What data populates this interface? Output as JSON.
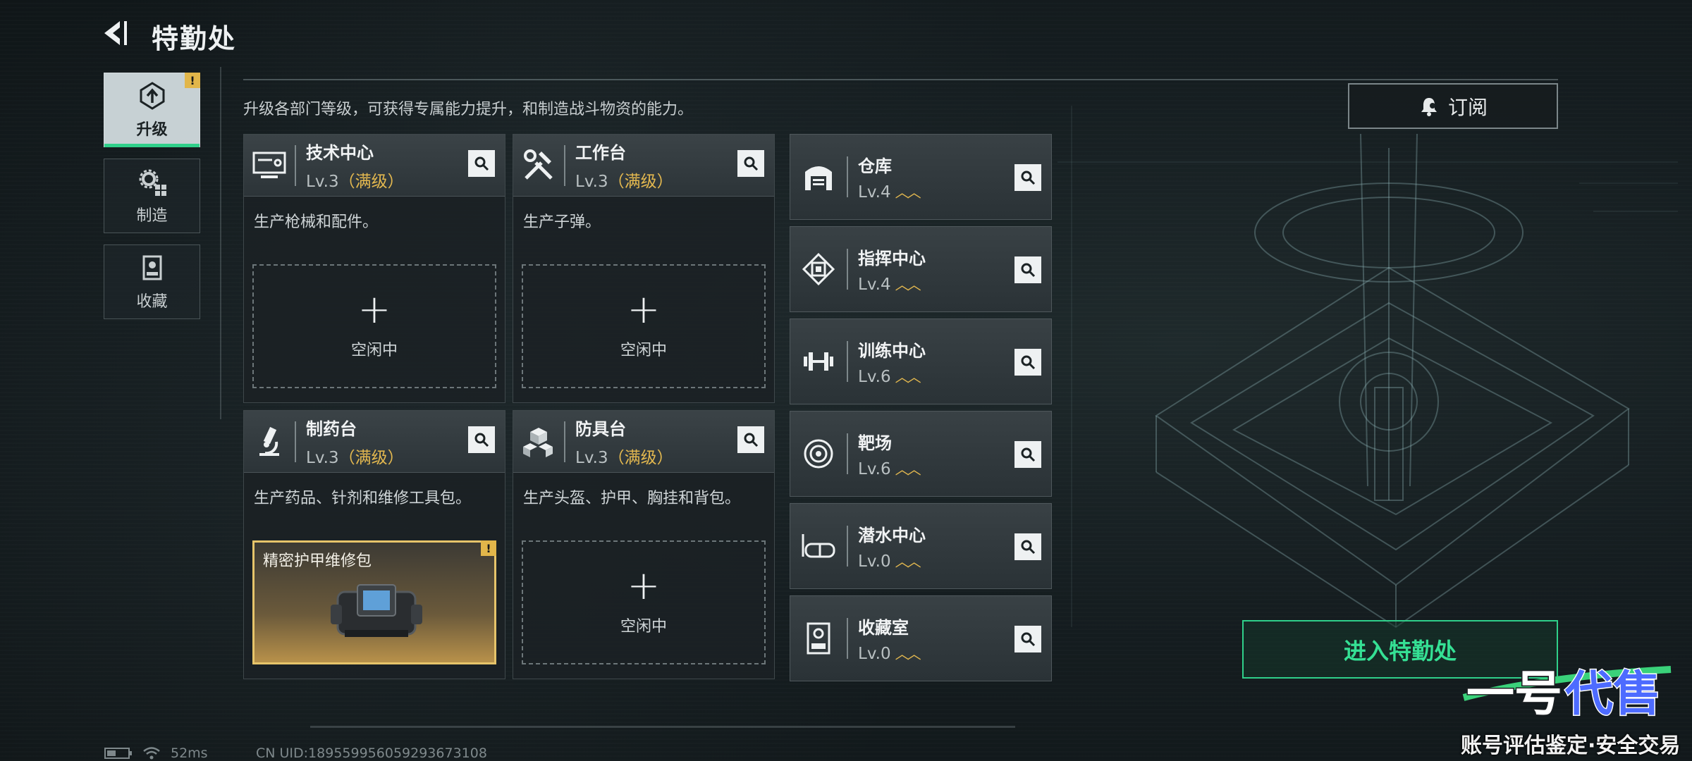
{
  "header": {
    "title": "特勤处",
    "back_icon": "back-arrow-icon"
  },
  "nav": {
    "items": [
      {
        "label": "升级",
        "icon": "upgrade-icon",
        "active": true,
        "badge": "!"
      },
      {
        "label": "制造",
        "icon": "gears-icon",
        "active": false
      },
      {
        "label": "收藏",
        "icon": "collection-icon",
        "active": false
      }
    ]
  },
  "intro_text": "升级各部门等级，可获得专属能力提升，和制造战斗物资的能力。",
  "subscribe": {
    "label": "订阅",
    "icon": "bell-icon"
  },
  "departments": [
    {
      "name": "技术中心",
      "level": "Lv.3",
      "max_label": "（满级）",
      "desc": "生产枪械和配件。",
      "icon": "terminal-icon",
      "slot": {
        "plus": "+",
        "status": "空闲中"
      }
    },
    {
      "name": "工作台",
      "level": "Lv.3",
      "max_label": "（满级）",
      "desc": "生产子弹。",
      "icon": "tools-icon",
      "slot": {
        "plus": "+",
        "status": "空闲中"
      }
    },
    {
      "name": "制药台",
      "level": "Lv.3",
      "max_label": "（满级）",
      "desc": "生产药品、针剂和维修工具包。",
      "icon": "microscope-icon",
      "item": {
        "name": "精密护甲维修包",
        "badge": "!"
      }
    },
    {
      "name": "防具台",
      "level": "Lv.3",
      "max_label": "（满级）",
      "desc": "生产头盔、护甲、胸挂和背包。",
      "icon": "armor-boxes-icon",
      "slot": {
        "plus": "+",
        "status": "空闲中"
      }
    }
  ],
  "facilities": [
    {
      "name": "仓库",
      "level": "Lv.4",
      "icon": "warehouse-icon"
    },
    {
      "name": "指挥中心",
      "level": "Lv.4",
      "icon": "chip-icon"
    },
    {
      "name": "训练中心",
      "level": "Lv.6",
      "icon": "dumbbell-icon"
    },
    {
      "name": "靶场",
      "level": "Lv.6",
      "icon": "target-icon"
    },
    {
      "name": "潜水中心",
      "level": "Lv.0",
      "icon": "diving-mask-icon"
    },
    {
      "name": "收藏室",
      "level": "Lv.0",
      "icon": "display-case-icon"
    }
  ],
  "enter_button": {
    "label": "进入特勤处"
  },
  "status_bar": {
    "ping": "52ms",
    "uid": "CN UID:1895599560592936731​08"
  },
  "watermark": {
    "logo_text": "一号代售",
    "tagline": "账号评估鉴定·安全交易"
  },
  "colors": {
    "accent_green": "#2fd08a",
    "max_gold": "#e3b84f",
    "item_gold": "#e6c46a"
  }
}
